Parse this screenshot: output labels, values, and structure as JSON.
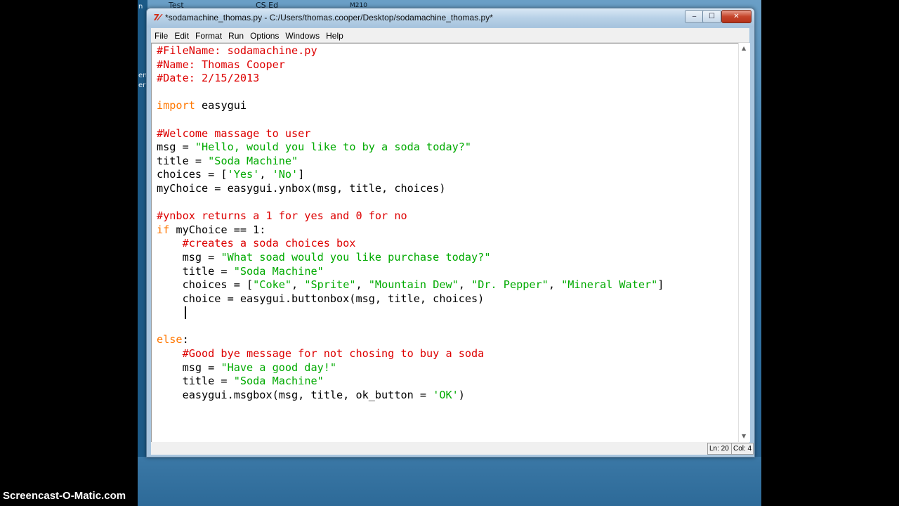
{
  "window": {
    "title": "*sodamachine_thomas.py - C:/Users/thomas.cooper/Desktop/sodamachine_thomas.py*",
    "app_icon": "7⁄",
    "minimize_icon": "‒",
    "maximize_icon": "☐",
    "close_icon": "✕"
  },
  "desktop": {
    "taskbar_labels": [
      "Test",
      "CS Ed",
      "M210"
    ],
    "left_edge_text": [
      "n",
      "ent",
      "er"
    ]
  },
  "menu": {
    "items": [
      "File",
      "Edit",
      "Format",
      "Run",
      "Options",
      "Windows",
      "Help"
    ]
  },
  "editor": {
    "lines": [
      "#FileName: sodamachine.py",
      "#Name: Thomas Cooper",
      "#Date: 2/15/2013",
      "",
      "import easygui",
      "",
      "#Welcome massage to user",
      "msg = \"Hello, would you like to by a soda today?\"",
      "title = \"Soda Machine\"",
      "choices = ['Yes', 'No']",
      "myChoice = easygui.ynbox(msg, title, choices)",
      "",
      "#ynbox returns a 1 for yes and 0 for no",
      "if myChoice == 1:",
      "    #creates a soda choices box",
      "    msg = \"What soad would you like purchase today?\"",
      "    title = \"Soda Machine\"",
      "    choices = [\"Coke\", \"Sprite\", \"Mountain Dew\", \"Dr. Pepper\", \"Mineral Water\"]",
      "    choice = easygui.buttonbox(msg, title, choices)",
      "    ",
      "",
      "else:",
      "    #Good bye message for not chosing to buy a soda",
      "    msg = \"Have a good day!\"",
      "    title = \"Soda Machine\"",
      "    easygui.msgbox(msg, title, ok_button = 'OK')"
    ]
  },
  "status": {
    "line": "Ln: 20",
    "col": "Col: 4"
  },
  "colors": {
    "comment": "#dd0000",
    "keyword": "#ff7700",
    "string": "#00aa00"
  },
  "watermark": "Screencast-O-Matic.com"
}
